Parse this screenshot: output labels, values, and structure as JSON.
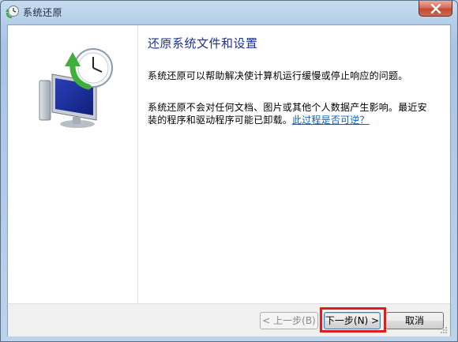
{
  "window": {
    "title": "系统还原",
    "close_icon": "close-icon",
    "title_icon": "system-restore-icon"
  },
  "content": {
    "heading": "还原系统文件和设置",
    "para1": "系统还原可以帮助解决使计算机运行缓慢或停止响应的问题。",
    "para2_prefix": "系统还原不会对任何文档、图片或其他个人数据产生影响。最近安装的程序和驱动程序可能已卸载。",
    "para2_link": "此过程是否可逆？",
    "hero_icon": "system-restore-computer-icon"
  },
  "buttons": {
    "prev": "< 上一步(B)",
    "next": "下一步(N) >",
    "cancel": "取消"
  },
  "colors": {
    "heading": "#1e3287",
    "link": "#0b5fb8",
    "highlight": "#e21b1b"
  }
}
